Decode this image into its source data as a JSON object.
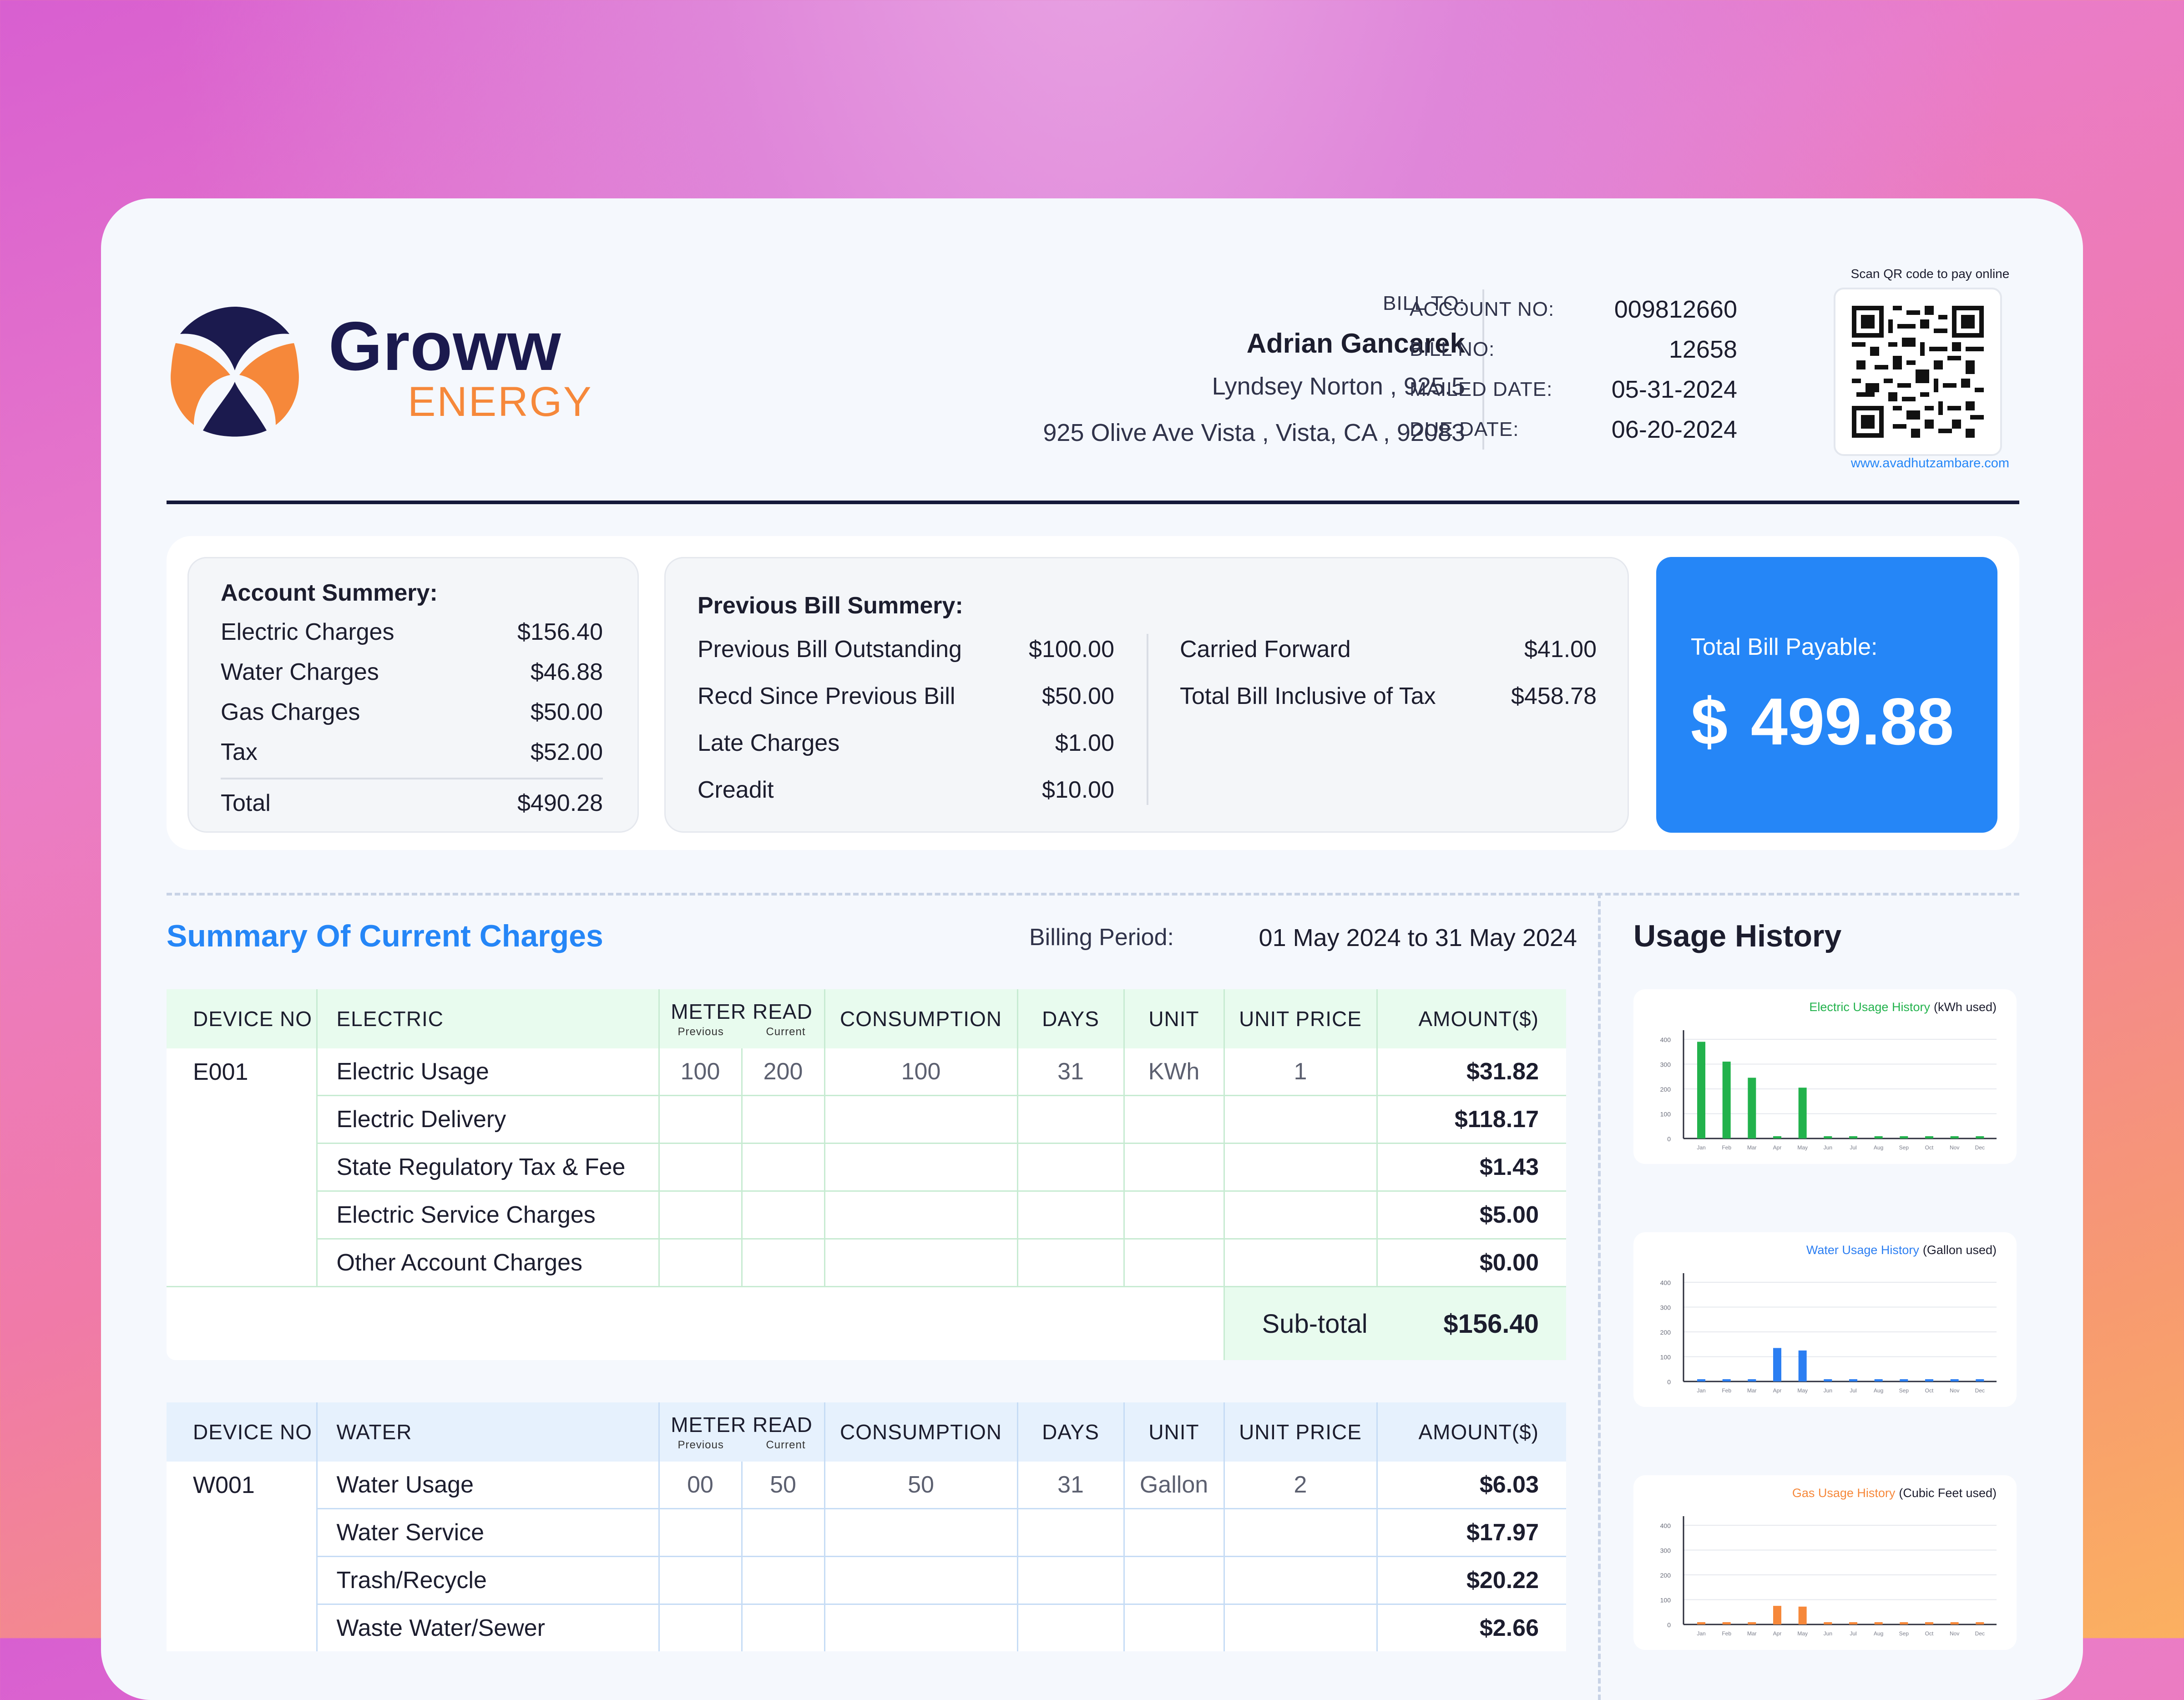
{
  "brand": {
    "name": "Groww",
    "sub": "ENERGY"
  },
  "bill_to": {
    "label": "BILL TO:",
    "name": "Adrian Gancarek",
    "line1": "Lyndsey Norton , 925.5",
    "line2": "925 Olive Ave Vista , Vista, CA , 92083"
  },
  "account": {
    "rows": [
      {
        "label": "ACCOUNT NO:",
        "value": "009812660"
      },
      {
        "label": "BILL NO:",
        "value": "12658"
      },
      {
        "label": "MAILED DATE:",
        "value": "05-31-2024"
      },
      {
        "label": "DUE DATE:",
        "value": "06-20-2024"
      }
    ]
  },
  "qr": {
    "caption": "Scan QR code to pay online",
    "url": "www.avadhutzambare.com"
  },
  "account_summary": {
    "title": "Account Summery:",
    "rows": [
      {
        "label": "Electric Charges",
        "value": "$156.40"
      },
      {
        "label": "Water Charges",
        "value": "$46.88"
      },
      {
        "label": "Gas Charges",
        "value": "$50.00"
      },
      {
        "label": "Tax",
        "value": "$52.00"
      }
    ],
    "total": {
      "label": "Total",
      "value": "$490.28"
    }
  },
  "previous_bill": {
    "title": "Previous Bill Summery:",
    "left": [
      {
        "label": "Previous Bill Outstanding",
        "value": "$100.00"
      },
      {
        "label": "Recd Since Previous Bill",
        "value": "$50.00"
      },
      {
        "label": "Late Charges",
        "value": "$1.00"
      },
      {
        "label": "Creadit",
        "value": "$10.00"
      }
    ],
    "right": [
      {
        "label": "Carried Forward",
        "value": "$41.00"
      },
      {
        "label": "Total Bill Inclusive of Tax",
        "value": "$458.78"
      }
    ]
  },
  "total_payable": {
    "label": "Total Bill Payable:",
    "currency": "$",
    "amount": "499.88"
  },
  "current_charges": {
    "title": "Summary Of Current Charges",
    "period_label": "Billing Period:",
    "period_value": "01 May 2024 to 31 May 2024"
  },
  "table_headers": {
    "device_no": "DEVICE NO",
    "meter_read": "METER READ",
    "previous": "Previous",
    "current": "Current",
    "consumption": "CONSUMPTION",
    "days": "DAYS",
    "unit": "UNIT",
    "unit_price": "UNIT PRICE",
    "amount": "AMOUNT($)"
  },
  "electric": {
    "category": "ELECTRIC",
    "device": "E001",
    "first": {
      "desc": "Electric Usage",
      "prev": "100",
      "curr": "200",
      "consumption": "100",
      "days": "31",
      "unit": "KWh",
      "unit_price": "1",
      "amount": "$31.82"
    },
    "rows": [
      {
        "desc": "Electric Delivery",
        "amount": "$118.17"
      },
      {
        "desc": "State Regulatory Tax & Fee",
        "amount": "$1.43"
      },
      {
        "desc": "Electric Service Charges",
        "amount": "$5.00"
      },
      {
        "desc": "Other Account Charges",
        "amount": "$0.00"
      }
    ],
    "subtotal_label": "Sub-total",
    "subtotal_value": "$156.40"
  },
  "water": {
    "category": "WATER",
    "device": "W001",
    "first": {
      "desc": "Water Usage",
      "prev": "00",
      "curr": "50",
      "consumption": "50",
      "days": "31",
      "unit": "Gallon",
      "unit_price": "2",
      "amount": "$6.03"
    },
    "rows": [
      {
        "desc": "Water Service",
        "amount": "$17.97"
      },
      {
        "desc": "Trash/Recycle",
        "amount": "$20.22"
      },
      {
        "desc": "Waste Water/Sewer",
        "amount": "$2.66"
      }
    ]
  },
  "usage_history": {
    "title": "Usage History"
  },
  "chart_data": [
    {
      "type": "bar",
      "title_colored": "Electric Usage History",
      "title_unit": "(kWh used)",
      "color": "#22b24c",
      "categories": [
        "Jan",
        "Feb",
        "Mar",
        "Apr",
        "May",
        "Jun",
        "Jul",
        "Aug",
        "Sep",
        "Oct",
        "Nov",
        "Dec"
      ],
      "values": [
        390,
        310,
        245,
        8,
        205,
        5,
        5,
        5,
        5,
        5,
        5,
        5
      ],
      "ylim": [
        0,
        400
      ],
      "yticks": [
        "0",
        "100",
        "200",
        "300",
        "400"
      ]
    },
    {
      "type": "bar",
      "title_colored": "Water Usage History",
      "title_unit": "(Gallon used)",
      "color": "#2b7ef2",
      "categories": [
        "Jan",
        "Feb",
        "Mar",
        "Apr",
        "May",
        "Jun",
        "Jul",
        "Aug",
        "Sep",
        "Oct",
        "Nov",
        "Dec"
      ],
      "values": [
        8,
        8,
        8,
        135,
        125,
        8,
        8,
        8,
        8,
        8,
        8,
        8
      ],
      "ylim": [
        0,
        400
      ],
      "yticks": [
        "0",
        "100",
        "200",
        "300",
        "400"
      ]
    },
    {
      "type": "bar",
      "title_colored": "Gas Usage History",
      "title_unit": "(Cubic Feet used)",
      "color": "#f6883a",
      "categories": [
        "Jan",
        "Feb",
        "Mar",
        "Apr",
        "May",
        "Jun",
        "Jul",
        "Aug",
        "Sep",
        "Oct",
        "Nov",
        "Dec"
      ],
      "values": [
        8,
        8,
        8,
        75,
        72,
        8,
        8,
        8,
        8,
        8,
        8,
        8
      ],
      "ylim": [
        0,
        400
      ],
      "yticks": [
        "0",
        "100",
        "200",
        "300",
        "400"
      ]
    }
  ]
}
